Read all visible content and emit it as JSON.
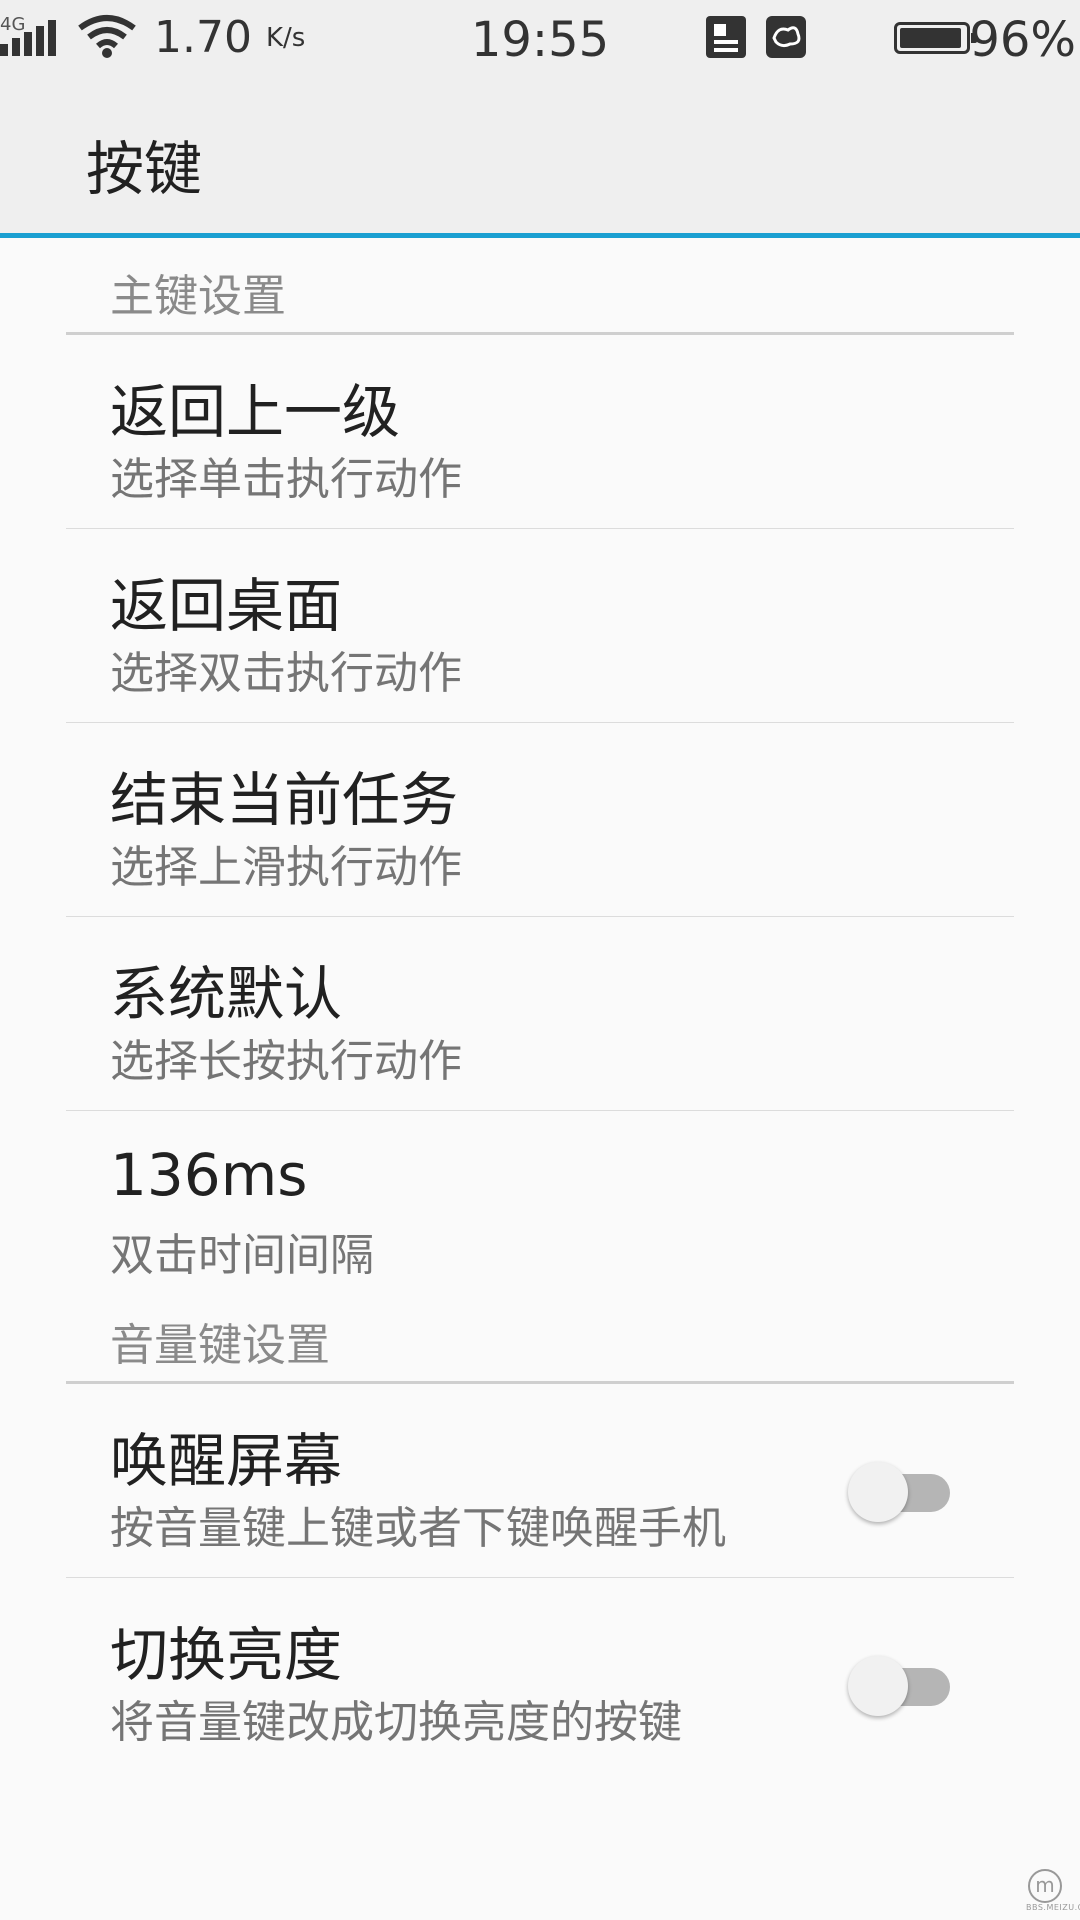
{
  "status_bar": {
    "network": "4G",
    "speed_value": "1.70",
    "speed_unit": "K/s",
    "time": "19:55",
    "battery_percent": "96%",
    "battery_level": 0.96
  },
  "app_bar": {
    "title": "按键"
  },
  "sections": {
    "main_key": {
      "header": "主键设置",
      "items": [
        {
          "title": "返回上一级",
          "subtitle": "选择单击执行动作"
        },
        {
          "title": "返回桌面",
          "subtitle": "选择双击执行动作"
        },
        {
          "title": "结束当前任务",
          "subtitle": "选择上滑执行动作"
        },
        {
          "title": "系统默认",
          "subtitle": "选择长按执行动作"
        },
        {
          "title": "136ms",
          "subtitle": "双击时间间隔"
        }
      ]
    },
    "volume_key": {
      "header": "音量键设置",
      "items": [
        {
          "title": "唤醒屏幕",
          "subtitle": "按音量键上键或者下键唤醒手机",
          "enabled": false
        },
        {
          "title": "切换亮度",
          "subtitle": "将音量键改成切换亮度的按键",
          "enabled": false
        }
      ]
    }
  },
  "watermark": {
    "logo": "m",
    "text": "BBS.MEIZU.CN"
  }
}
